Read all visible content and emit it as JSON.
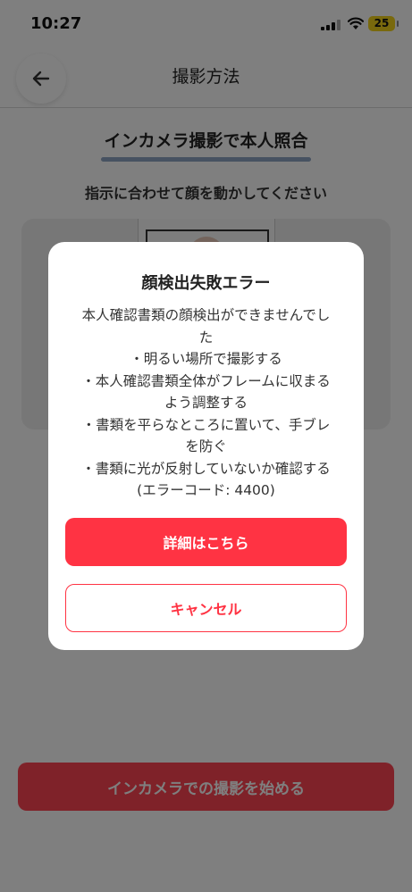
{
  "status_bar": {
    "time": "10:27",
    "battery": "25"
  },
  "nav": {
    "title": "撮影方法"
  },
  "section": {
    "title": "インカメラ撮影で本人照合",
    "instruction": "指示に合わせて顔を動かしてください"
  },
  "start_button": {
    "label": "インカメラでの撮影を始める"
  },
  "dialog": {
    "title": "顔検出失敗エラー",
    "lines": [
      "本人確認書類の顔検出ができませんでし\nた",
      "・明るい場所で撮影する",
      "・本人確認書類全体がフレームに収まる\nよう調整する",
      "・書類を平らなところに置いて、手ブレ\nを防ぐ",
      "・書類に光が反射していないか確認する",
      "(エラーコード: 4400)"
    ],
    "details_button": "詳細はこちら",
    "cancel_button": "キャンセル"
  },
  "colors": {
    "accent": "#ff3343",
    "overlay": "rgba(0,0,0,0.5)",
    "underline": "#8ea4c3",
    "battery": "#f2d21a"
  }
}
